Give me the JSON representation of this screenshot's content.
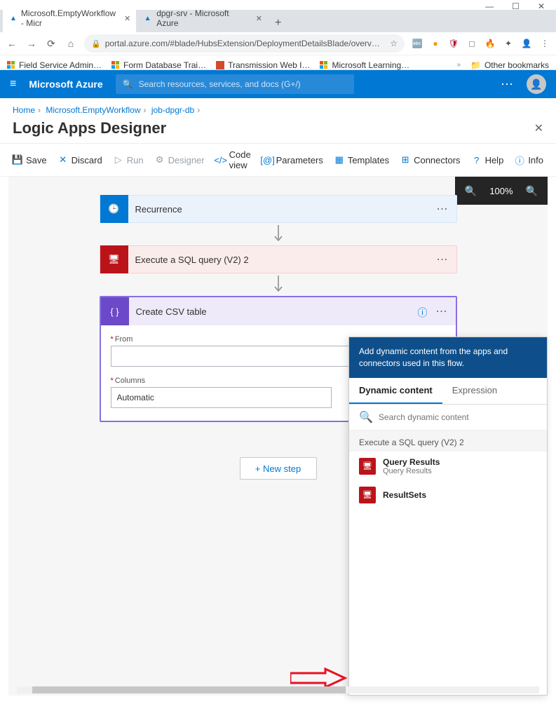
{
  "window": {
    "min": "—",
    "max": "☐",
    "close": "✕"
  },
  "tabs": {
    "t1": "Microsoft.EmptyWorkflow - Micr",
    "t2": "dpgr-srv - Microsoft Azure"
  },
  "addr": {
    "url": "portal.azure.com/#blade/HubsExtension/DeploymentDetailsBlade/overv…"
  },
  "bookmarks": {
    "b1": "Field Service Admin…",
    "b2": "Form Database Trai…",
    "b3": "Transmission Web I…",
    "b4": "Microsoft Learning…",
    "other": "Other bookmarks"
  },
  "azure": {
    "brand": "Microsoft Azure",
    "search_ph": "Search resources, services, and docs (G+/)"
  },
  "crumbs": {
    "c1": "Home",
    "c2": "Microsoft.EmptyWorkflow",
    "c3": "job-dpgr-db"
  },
  "page": {
    "title": "Logic Apps Designer"
  },
  "toolbar": {
    "save": "Save",
    "discard": "Discard",
    "run": "Run",
    "designer": "Designer",
    "code": "Code view",
    "params": "Parameters",
    "templates": "Templates",
    "connectors": "Connectors",
    "help": "Help",
    "info": "Info"
  },
  "zoom": "100%",
  "steps": {
    "recurrence": "Recurrence",
    "sql": "Execute a SQL query (V2) 2",
    "csv": "Create CSV table"
  },
  "csv": {
    "from_label": "From",
    "cols_label": "Columns",
    "cols_value": "Automatic"
  },
  "newstep": "+ New step",
  "dpanel": {
    "head": "Add dynamic content from the apps and connectors used in this flow.",
    "tab1": "Dynamic content",
    "tab2": "Expression",
    "search_ph": "Search dynamic content",
    "group": "Execute a SQL query (V2) 2",
    "item1_t": "Query Results",
    "item1_s": "Query Results",
    "item2_t": "ResultSets"
  }
}
